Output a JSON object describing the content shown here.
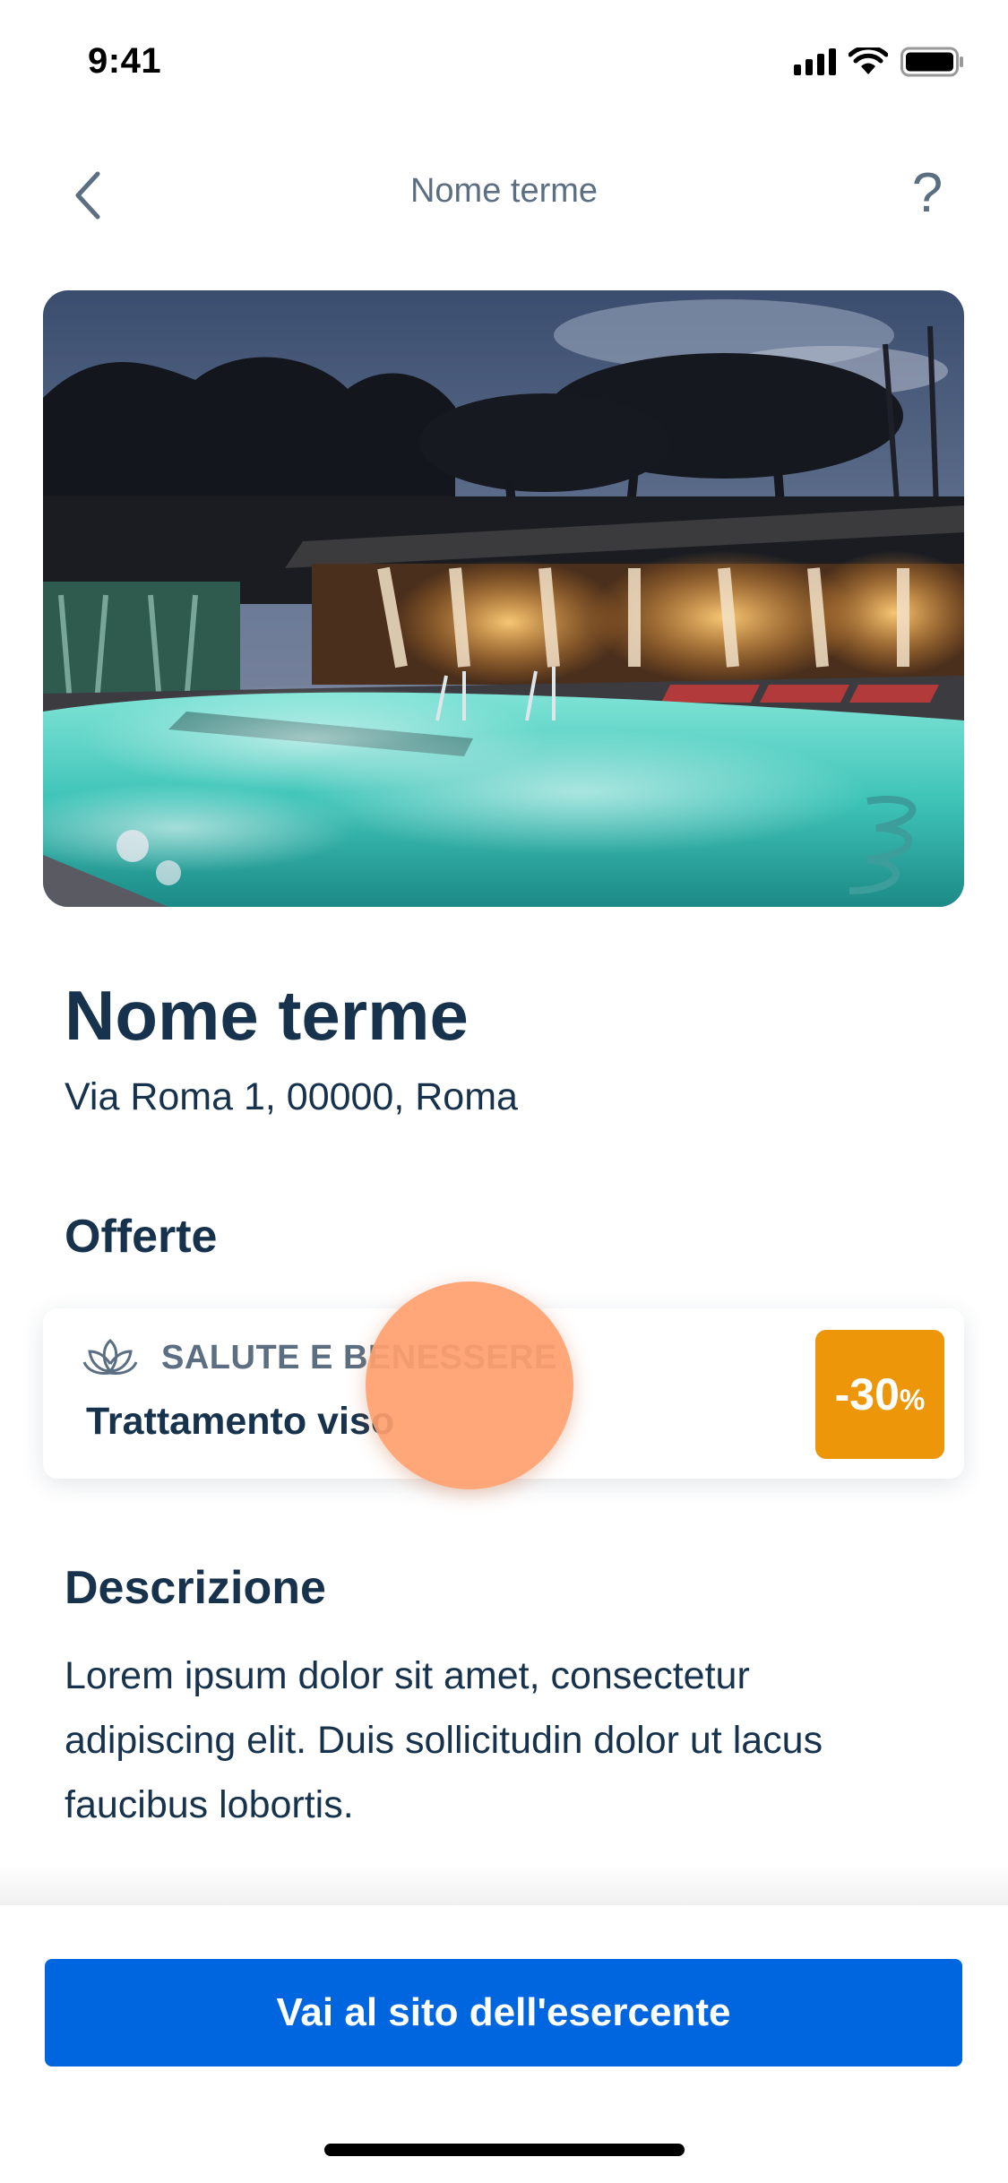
{
  "status_bar": {
    "time": "9:41"
  },
  "nav": {
    "title": "Nome terme",
    "back_icon": "chevron-left-icon",
    "help_label": "?"
  },
  "hero": {
    "image_alt": "Night view of a thermal spa pool with steaming turquoise water and lit pavilion"
  },
  "venue": {
    "name": "Nome terme",
    "address": "Via Roma 1, 00000, Roma"
  },
  "offers": {
    "section_title": "Offerte",
    "items": [
      {
        "category_icon": "lotus-icon",
        "category": "SALUTE E BENESSERE",
        "title": "Trattamento viso",
        "discount": "-30",
        "discount_unit": "%",
        "badge_color": "#ee960a"
      }
    ]
  },
  "description": {
    "section_title": "Descrizione",
    "text": "Lorem ipsum dolor sit amet, consectetur adipiscing elit. Duis sollicitudin dolor ut lacus faucibus lobortis."
  },
  "cta": {
    "label": "Vai al sito dell'esercente",
    "color": "#0066e0"
  },
  "colors": {
    "primary_text": "#17324d",
    "secondary_text": "#5c6f82",
    "tap_indicator": "#ffa06e"
  }
}
